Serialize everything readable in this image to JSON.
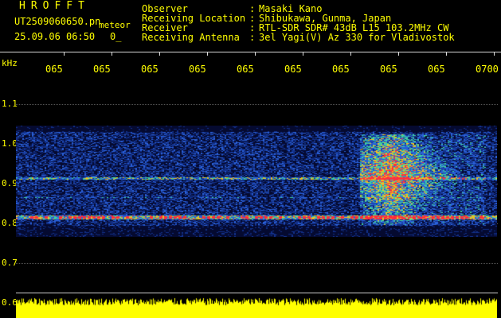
{
  "header": {
    "app_title": "HROFFT",
    "file_name": "UT2509060650.pn",
    "meteor_label": "meteor",
    "datetime": "25.09.06 06:50",
    "count": "0_"
  },
  "station": [
    {
      "label": "Observer",
      "value": "Masaki Kano"
    },
    {
      "label": "Receiving Location",
      "value": "Shibukawa, Gunma, Japan"
    },
    {
      "label": "Receiver",
      "value": "RTL-SDR SDR# 43dB L15 103.2MHz CW"
    },
    {
      "label": "Receiving Antenna",
      "value": "3el Yagi(V) Az 330 for Vladivostok"
    }
  ],
  "separator": ":",
  "axis": {
    "unit": "kHz",
    "x_ticks": [
      "065",
      "065",
      "065",
      "065",
      "065",
      "065",
      "065",
      "065",
      "065",
      "0700"
    ],
    "y_ticks": [
      "1.1",
      "1.0",
      "0.9",
      "0.8",
      "0.7",
      "0.6"
    ]
  },
  "colors": {
    "text": "#ffff00",
    "background": "#000000",
    "noise": "#0a2a8a",
    "echo": "#ff3030",
    "signal": "#ffff00"
  }
}
